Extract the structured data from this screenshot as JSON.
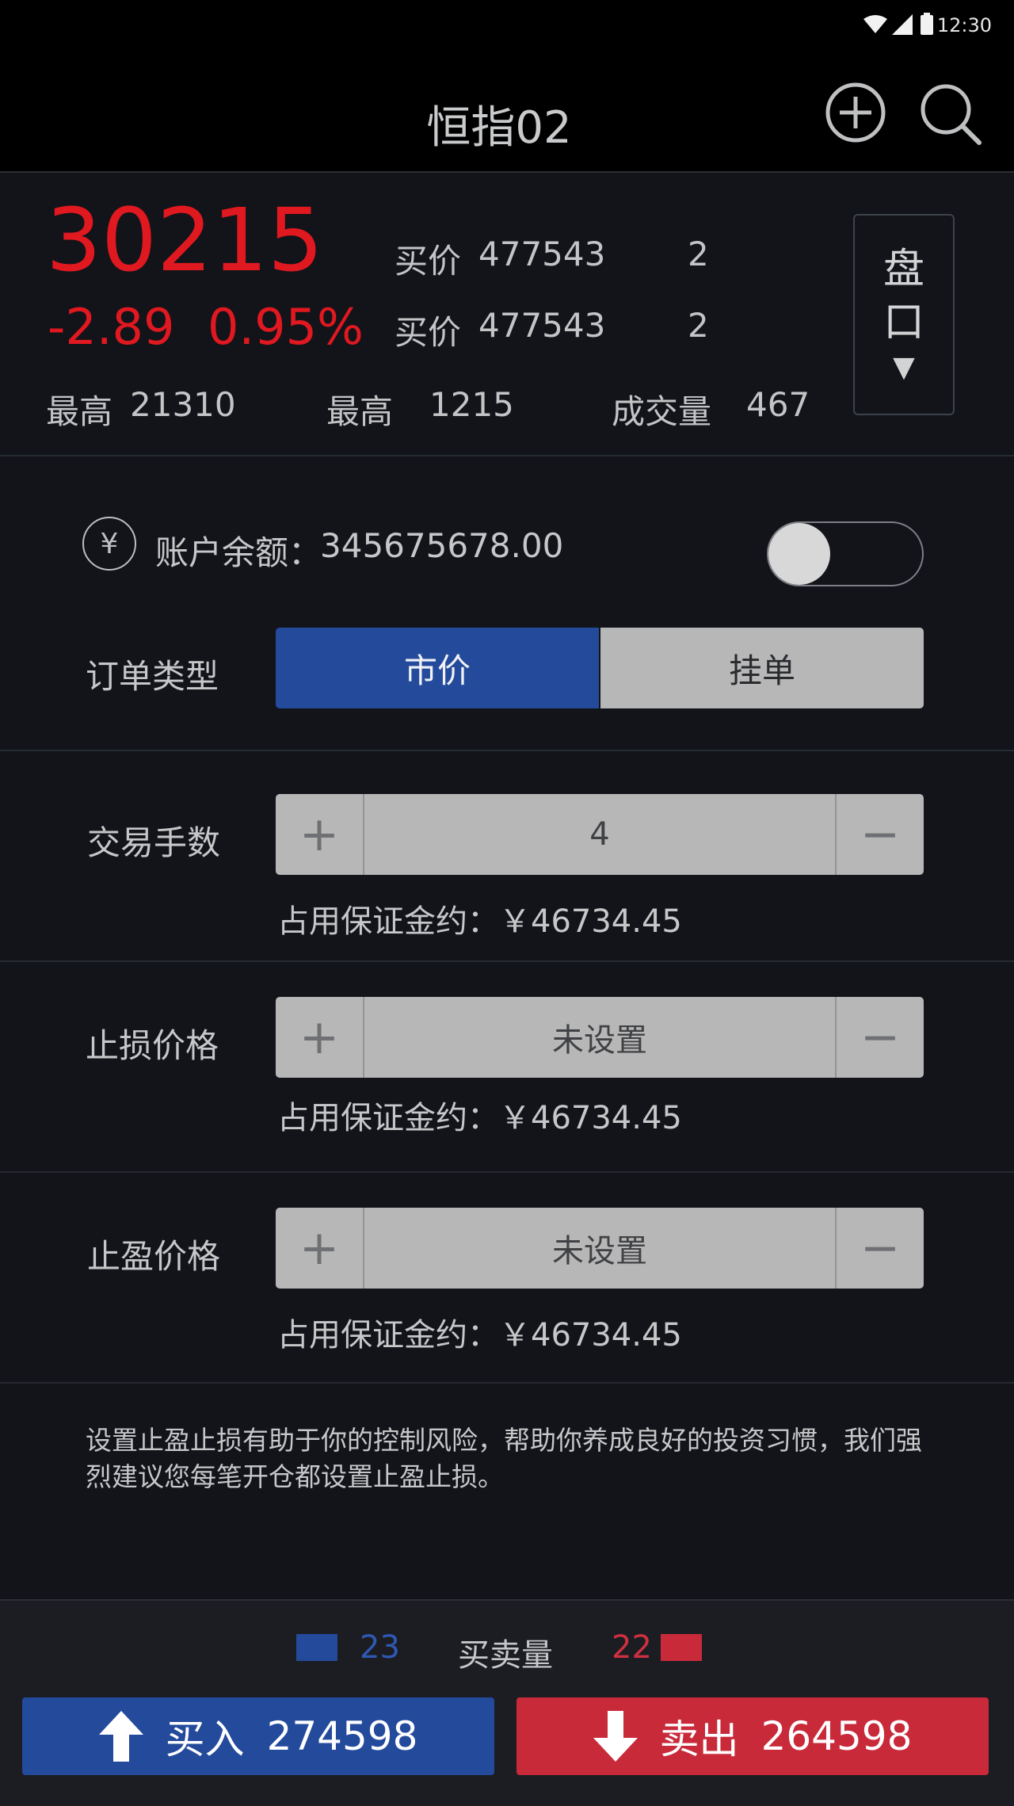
{
  "status": {
    "time": "12:30"
  },
  "header": {
    "title": "恒指02"
  },
  "quote": {
    "price": "30215",
    "change": "-2.89",
    "change_pct": "0.95%",
    "bids": [
      {
        "label": "买价",
        "price": "477543",
        "qty": "2"
      },
      {
        "label": "买价",
        "price": "477543",
        "qty": "2"
      }
    ],
    "stats": [
      {
        "label": "最高",
        "value": "21310"
      },
      {
        "label": "最高",
        "value": "1215"
      },
      {
        "label": "成交量",
        "value": "467"
      }
    ],
    "pankou": {
      "line1": "盘",
      "line2": "口",
      "arrow": "▼"
    }
  },
  "account": {
    "yen_symbol": "¥",
    "label": "账户余额：",
    "balance": "345675678.00",
    "toggle_on": false
  },
  "order_type": {
    "label": "订单类型",
    "options": [
      "市价",
      "挂单"
    ],
    "selected": "市价"
  },
  "lots": {
    "label": "交易手数",
    "value": "4",
    "margin": "占用保证金约：￥46734.45"
  },
  "stop_loss": {
    "label": "止损价格",
    "value": "未设置",
    "margin": "占用保证金约：￥46734.45"
  },
  "take_profit": {
    "label": "止盈价格",
    "value": "未设置",
    "margin": "占用保证金约：￥46734.45"
  },
  "tip": "设置止盈止损有助于你的控制风险，帮助你养成良好的投资习惯，我们强烈建议您每笔开仓都设置止盈止损。",
  "volume_bar": {
    "buy_count": "23",
    "label": "买卖量",
    "sell_count": "22"
  },
  "actions": {
    "buy": {
      "label": "买入",
      "value": "274598"
    },
    "sell": {
      "label": "卖出",
      "value": "264598"
    }
  },
  "colors": {
    "up_red": "#e01820",
    "brand_blue": "#244a9c",
    "sell_red": "#c82a3a"
  }
}
